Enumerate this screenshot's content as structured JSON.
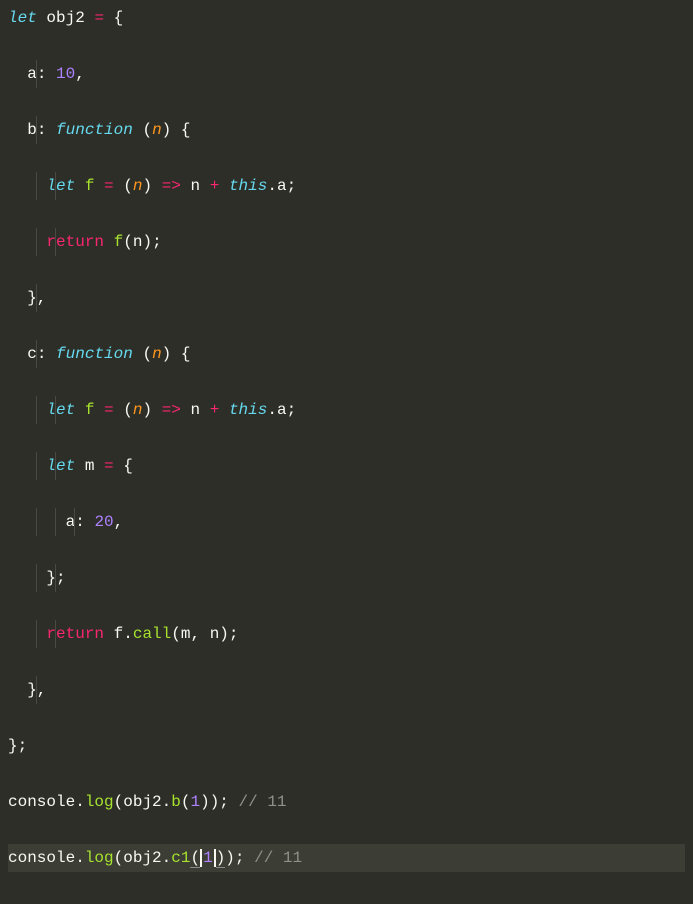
{
  "code": {
    "l1_let": "let",
    "l1_obj2": "obj2",
    "l1_eq": "=",
    "l1_brace": "{",
    "l2_a": "a",
    "l2_val": "10",
    "l3_b": "b",
    "l3_func": "function",
    "l3_param": "n",
    "l4_let": "let",
    "l4_f": "f",
    "l4_eq": "=",
    "l4_param": "n",
    "l4_arrow": "=>",
    "l4_n": "n",
    "l4_plus": "+",
    "l4_this": "this",
    "l4_a": "a",
    "l5_return": "return",
    "l5_f": "f",
    "l5_n": "n",
    "l7_c": "c",
    "l7_func": "function",
    "l7_param": "n",
    "l8_let": "let",
    "l8_f": "f",
    "l8_eq": "=",
    "l8_param": "n",
    "l8_arrow": "=>",
    "l8_n": "n",
    "l8_plus": "+",
    "l8_this": "this",
    "l8_a": "a",
    "l9_let": "let",
    "l9_m": "m",
    "l9_eq": "=",
    "l10_a": "a",
    "l10_val": "20",
    "l12_return": "return",
    "l12_f": "f",
    "l12_call": "call",
    "l12_m": "m",
    "l12_n": "n",
    "l15_console": "console",
    "l15_log": "log",
    "l15_obj2": "obj2",
    "l15_b": "b",
    "l15_arg": "1",
    "l15_comment": "// 11",
    "l16_console": "console",
    "l16_log": "log",
    "l16_obj2": "obj2",
    "l16_c1": "c1",
    "l16_arg": "1",
    "l16_comment": "// 11"
  }
}
